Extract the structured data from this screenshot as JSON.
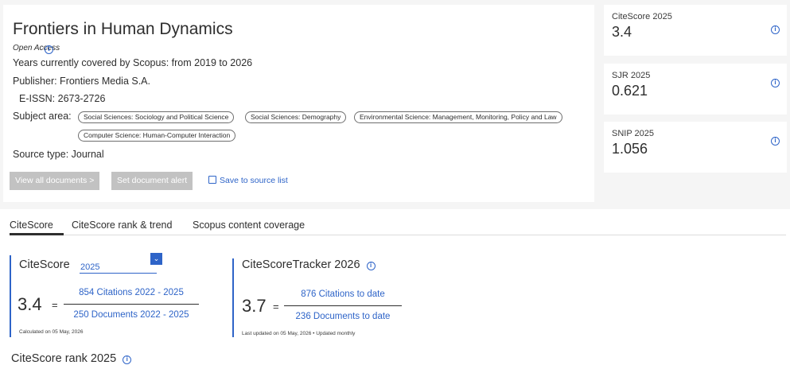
{
  "source": {
    "title": "Frontiers in Human Dynamics",
    "open_access": "Open Access",
    "years_covered": "Years currently covered by Scopus:  from 2019 to 2026",
    "publisher": "Publisher:  Frontiers Media S.A.",
    "eissn": "E-ISSN:  2673-2726",
    "subject_area_label": "Subject area:",
    "subject_areas": [
      "Social Sciences: Sociology and Political Science",
      "Social Sciences: Demography",
      "Environmental Science: Management, Monitoring, Policy and Law",
      "Computer Science: Human-Computer Interaction"
    ],
    "source_type": "Source type:  Journal"
  },
  "actions": {
    "view_all_documents": "View all documents >",
    "set_document_alert": "Set document alert",
    "save_to_source_list": "Save to source list"
  },
  "metrics": [
    {
      "label": "CiteScore 2025",
      "value": "3.4"
    },
    {
      "label": "SJR 2025",
      "value": "0.621"
    },
    {
      "label": "SNIP 2025",
      "value": "1.056"
    }
  ],
  "tabs": [
    "CiteScore",
    "CiteScore rank & trend",
    "Scopus content coverage"
  ],
  "citescore": {
    "title": "CiteScore",
    "year": "2025",
    "value": "3.4",
    "equals": "=",
    "numerator": "854 Citations 2022 - 2025",
    "denominator": "250 Documents 2022 - 2025",
    "footnote": "Calculated on 05 May, 2026"
  },
  "tracker": {
    "title": "CiteScoreTracker 2026",
    "value": "3.7",
    "equals": "=",
    "numerator": "876 Citations to date",
    "denominator": "236 Documents to date",
    "footnote": "Last updated on 05 May, 2026 • Updated monthly"
  },
  "rank": {
    "title": "CiteScore rank 2025"
  },
  "colors": {
    "accent": "#2e64c8",
    "button_disabled": "#c2c2c2",
    "band": "#f5f5f5"
  },
  "icons": [
    "info-icon",
    "save-icon",
    "chevron-down-icon"
  ]
}
